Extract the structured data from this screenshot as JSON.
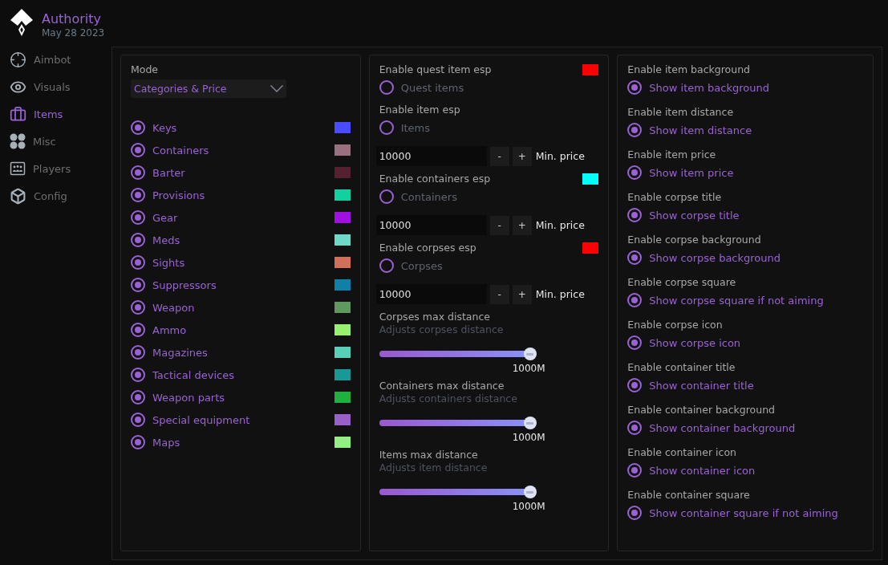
{
  "brand": {
    "title": "Authority",
    "date": "May 28 2023"
  },
  "nav": [
    {
      "label": "Aimbot",
      "kind": "crosshair",
      "selected": false
    },
    {
      "label": "Visuals",
      "kind": "eye",
      "selected": false
    },
    {
      "label": "Items",
      "kind": "briefcase",
      "selected": true
    },
    {
      "label": "Misc",
      "kind": "grid",
      "selected": false
    },
    {
      "label": "Players",
      "kind": "players",
      "selected": false
    },
    {
      "label": "Config",
      "kind": "cube",
      "selected": false
    }
  ],
  "categories": {
    "mode_label": "Mode",
    "mode_value": "Categories & Price",
    "items": [
      {
        "label": "Keys",
        "checked": true,
        "color": "#4b4bff"
      },
      {
        "label": "Containers",
        "checked": true,
        "color": "#98707f"
      },
      {
        "label": "Barter",
        "checked": true,
        "color": "#552030"
      },
      {
        "label": "Provisions",
        "checked": true,
        "color": "#12d0a0"
      },
      {
        "label": "Gear",
        "checked": true,
        "color": "#a010e0"
      },
      {
        "label": "Meds",
        "checked": true,
        "color": "#70d8c8"
      },
      {
        "label": "Sights",
        "checked": true,
        "color": "#d07058"
      },
      {
        "label": "Suppressors",
        "checked": true,
        "color": "#1080a8"
      },
      {
        "label": "Weapon",
        "checked": true,
        "color": "#609860"
      },
      {
        "label": "Ammo",
        "checked": true,
        "color": "#98f070"
      },
      {
        "label": "Magazines",
        "checked": true,
        "color": "#58d0b8"
      },
      {
        "label": "Tactical devices",
        "checked": true,
        "color": "#1a9898"
      },
      {
        "label": "Weapon parts",
        "checked": true,
        "color": "#20b040"
      },
      {
        "label": "Special equipment",
        "checked": true,
        "color": "#9860c8"
      },
      {
        "label": "Maps",
        "checked": true,
        "color": "#90f080"
      }
    ]
  },
  "esp": [
    {
      "kind": "toggle",
      "title": "Enable quest item esp",
      "label": "Quest items",
      "checked": false,
      "color": "#ff0000"
    },
    {
      "kind": "toggle",
      "title": "Enable item esp",
      "label": "Items",
      "checked": false,
      "price": {
        "value": "10000",
        "minus": "-",
        "plus": "+",
        "label": "Min. price"
      }
    },
    {
      "kind": "toggle",
      "title": "Enable containers esp",
      "label": "Containers",
      "checked": false,
      "color": "#00ffff",
      "price": {
        "value": "10000",
        "minus": "-",
        "plus": "+",
        "label": "Min. price"
      }
    },
    {
      "kind": "toggle",
      "title": "Enable corpses esp",
      "label": "Corpses",
      "checked": false,
      "color": "#ff0000",
      "price": {
        "value": "10000",
        "minus": "-",
        "plus": "+",
        "label": "Min. price"
      }
    },
    {
      "kind": "slider",
      "title": "Corpses max distance",
      "subtitle": "Adjusts corpses distance",
      "level": 1,
      "reading": "1000M"
    },
    {
      "kind": "slider",
      "title": "Containers max distance",
      "subtitle": "Adjusts containers distance",
      "level": 1,
      "reading": "1000M"
    },
    {
      "kind": "slider",
      "title": "Items max distance",
      "subtitle": "Adjusts item distance",
      "level": 1,
      "reading": "1000M"
    }
  ],
  "display": [
    {
      "title": "Enable item background",
      "label": "Show item background",
      "checked": true
    },
    {
      "title": "Enable item distance",
      "label": "Show item distance",
      "checked": true
    },
    {
      "title": "Enable item price",
      "label": "Show item price",
      "checked": true
    },
    {
      "title": "Enable corpse title",
      "label": "Show corpse title",
      "checked": true
    },
    {
      "title": "Enable corpse background",
      "label": "Show corpse background",
      "checked": true
    },
    {
      "title": "Enable corpse square",
      "label": "Show corpse square if not aiming",
      "checked": true
    },
    {
      "title": "Enable corpse icon",
      "label": "Show corpse icon",
      "checked": true
    },
    {
      "title": "Enable container title",
      "label": "Show container title",
      "checked": true
    },
    {
      "title": "Enable container background",
      "label": "Show container background",
      "checked": true
    },
    {
      "title": "Enable container icon",
      "label": "Show container icon",
      "checked": true
    },
    {
      "title": "Enable container square",
      "label": "Show container square if not aiming",
      "checked": true
    }
  ]
}
